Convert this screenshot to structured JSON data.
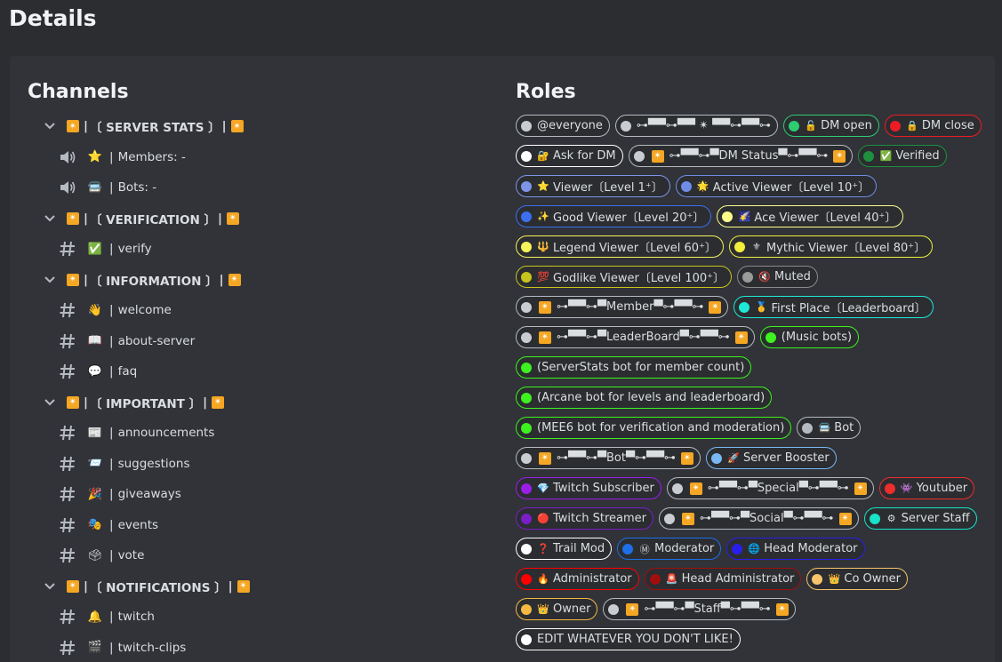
{
  "page": {
    "title": "Details"
  },
  "channels": {
    "title": "Channels",
    "items": [
      {
        "type": "category",
        "label": "〔 SERVER STATS 〕"
      },
      {
        "type": "voice",
        "emoji": "⭐",
        "label": "Members: -"
      },
      {
        "type": "voice",
        "emoji": "🚍",
        "label": "Bots: -"
      },
      {
        "type": "category",
        "label": "〔 VERIFICATION 〕"
      },
      {
        "type": "text",
        "emoji": "✅",
        "label": "verify"
      },
      {
        "type": "category",
        "label": "〔 INFORMATION 〕"
      },
      {
        "type": "text",
        "emoji": "👋",
        "label": "welcome"
      },
      {
        "type": "text",
        "emoji": "📖",
        "label": "about-server"
      },
      {
        "type": "text",
        "emoji": "💬",
        "label": "faq"
      },
      {
        "type": "category",
        "label": "〔 IMPORTANT 〕"
      },
      {
        "type": "text",
        "emoji": "📰",
        "label": "announcements"
      },
      {
        "type": "text",
        "emoji": "📨",
        "label": "suggestions"
      },
      {
        "type": "text",
        "emoji": "🎉",
        "label": "giveaways"
      },
      {
        "type": "text",
        "emoji": "🎭",
        "label": "events"
      },
      {
        "type": "text",
        "emoji": "🗳",
        "label": "vote"
      },
      {
        "type": "category",
        "label": "〔 NOTIFICATIONS 〕"
      },
      {
        "type": "text",
        "emoji": "🔔",
        "label": "twitch"
      },
      {
        "type": "text",
        "emoji": "🎬",
        "label": "twitch-clips"
      }
    ]
  },
  "roles": {
    "title": "Roles",
    "items": [
      {
        "label": "@everyone",
        "dot": "#c9cdd2",
        "border": "#b5bac1",
        "icon": ""
      },
      {
        "label": "⊶▀▀⊶▀▀ ✴ ▀▀⊶▀▀⊶",
        "dot": "#c9cdd2",
        "border": "#b5bac1",
        "icon": ""
      },
      {
        "label": "DM open",
        "dot": "#2ecc71",
        "border": "#2ecc71",
        "icon": "🔓"
      },
      {
        "label": "DM close",
        "dot": "#ed1c24",
        "border": "#ed1c24",
        "icon": "🔒"
      },
      {
        "label": "Ask for DM",
        "dot": "#ffffff",
        "border": "#ffffff",
        "icon": "🔐"
      },
      {
        "label": "⊶▀▀⊶▀DM Status▀⊶▀▀⊶",
        "dot": "#c9cdd2",
        "border": "#b5bac1",
        "icon": "✴",
        "suffix": "✴"
      },
      {
        "label": "Verified",
        "dot": "#1e8f3e",
        "border": "#1e8f3e",
        "icon": "✅"
      },
      {
        "label": "Viewer〔Level 1⁺〕",
        "dot": "#7d95e8",
        "border": "#7d95e8",
        "icon": "⭐"
      },
      {
        "label": "Active Viewer〔Level 10⁺〕",
        "dot": "#6f8de6",
        "border": "#6f8de6",
        "icon": "🌟"
      },
      {
        "label": "Good Viewer〔Level 20⁺〕",
        "dot": "#3c6ef0",
        "border": "#3c6ef0",
        "icon": "✨"
      },
      {
        "label": "Ace Viewer〔Level 40⁺〕",
        "dot": "#fffd8a",
        "border": "#fffd8a",
        "icon": "🌠"
      },
      {
        "label": "Legend Viewer〔Level 60⁺〕",
        "dot": "#f6f35a",
        "border": "#f6f35a",
        "icon": "🔱"
      },
      {
        "label": "Mythic Viewer〔Level 80⁺〕",
        "dot": "#f2ee3c",
        "border": "#f2ee3c",
        "icon": "⚜"
      },
      {
        "label": "Godlike Viewer〔Level 100⁺〕",
        "dot": "#c7c51c",
        "border": "#c7c51c",
        "icon": "💯"
      },
      {
        "label": "Muted",
        "dot": "#9a9a9a",
        "border": "#8a8a8a",
        "icon": "🔇"
      },
      {
        "label": "⊶▀▀⊶▀Member▀⊶▀▀⊶",
        "dot": "#c9cdd2",
        "border": "#b5bac1",
        "icon": "✴",
        "suffix": "✴"
      },
      {
        "label": "First Place〔Leaderboard〕",
        "dot": "#1de9d6",
        "border": "#1de9d6",
        "icon": "🥇"
      },
      {
        "label": "⊶▀▀⊶▀LeaderBoard▀⊶▀▀⊶",
        "dot": "#c9cdd2",
        "border": "#b5bac1",
        "icon": "✴",
        "suffix": "✴"
      },
      {
        "label": "(Music bots)",
        "dot": "#3df21e",
        "border": "#3df21e",
        "icon": ""
      },
      {
        "label": "(ServerStats bot for member count)",
        "dot": "#3df21e",
        "border": "#3df21e",
        "icon": ""
      },
      {
        "label": "(Arcane bot for levels and leaderboard)",
        "dot": "#3df21e",
        "border": "#3df21e",
        "icon": ""
      },
      {
        "label": "(MEE6 bot for verification and moderation)",
        "dot": "#3df21e",
        "border": "#3df21e",
        "icon": ""
      },
      {
        "label": "Bot",
        "dot": "#b5bac1",
        "border": "#b5bac1",
        "icon": "🚍"
      },
      {
        "label": "⊶▀▀⊶▀Bot▀⊶▀▀⊶",
        "dot": "#c9cdd2",
        "border": "#b5bac1",
        "icon": "✴",
        "suffix": "✴"
      },
      {
        "label": "Server Booster",
        "dot": "#7ab7f5",
        "border": "#7ab7f5",
        "icon": "🚀"
      },
      {
        "label": "Twitch Subscriber",
        "dot": "#9b1ee8",
        "border": "#9b1ee8",
        "icon": "💎"
      },
      {
        "label": "⊶▀▀⊶▀Special▀⊶▀▀⊶",
        "dot": "#c9cdd2",
        "border": "#b5bac1",
        "icon": "✴",
        "suffix": "✴"
      },
      {
        "label": "Youtuber",
        "dot": "#ee2d2d",
        "border": "#ee2d2d",
        "icon": "👾"
      },
      {
        "label": "Twitch Streamer",
        "dot": "#7a1ec8",
        "border": "#7a1ec8",
        "icon": "🔴"
      },
      {
        "label": "⊶▀▀⊶▀Social▀⊶▀▀⊶",
        "dot": "#c9cdd2",
        "border": "#b5bac1",
        "icon": "✴",
        "suffix": "✴"
      },
      {
        "label": "Server Staff",
        "dot": "#17e3c8",
        "border": "#17e3c8",
        "icon": "⚙"
      },
      {
        "label": "Trail Mod",
        "dot": "#ffffff",
        "border": "#ffffff",
        "icon": "❓"
      },
      {
        "label": "Moderator",
        "dot": "#1e6fe8",
        "border": "#1e6fe8",
        "icon": "Ⓜ"
      },
      {
        "label": "Head Moderator",
        "dot": "#2a1eed",
        "border": "#2a1eed",
        "icon": "🌐"
      },
      {
        "label": "Administrator",
        "dot": "#ff0000",
        "border": "#ff0000",
        "icon": "🔥"
      },
      {
        "label": "Head Administrator",
        "dot": "#a10e0e",
        "border": "#a10e0e",
        "icon": "🚨"
      },
      {
        "label": "Co Owner",
        "dot": "#f7c46c",
        "border": "#f7c46c",
        "icon": "👑"
      },
      {
        "label": "Owner",
        "dot": "#f5b942",
        "border": "#f5b942",
        "icon": "👑"
      },
      {
        "label": "⊶▀▀⊶▀Staff▀⊶▀▀⊶",
        "dot": "#c9cdd2",
        "border": "#b5bac1",
        "icon": "✴",
        "suffix": "✴"
      },
      {
        "label": "EDIT WHATEVER YOU DON'T LIKE!",
        "dot": "#ffffff",
        "border": "#ffffff",
        "icon": ""
      }
    ]
  }
}
